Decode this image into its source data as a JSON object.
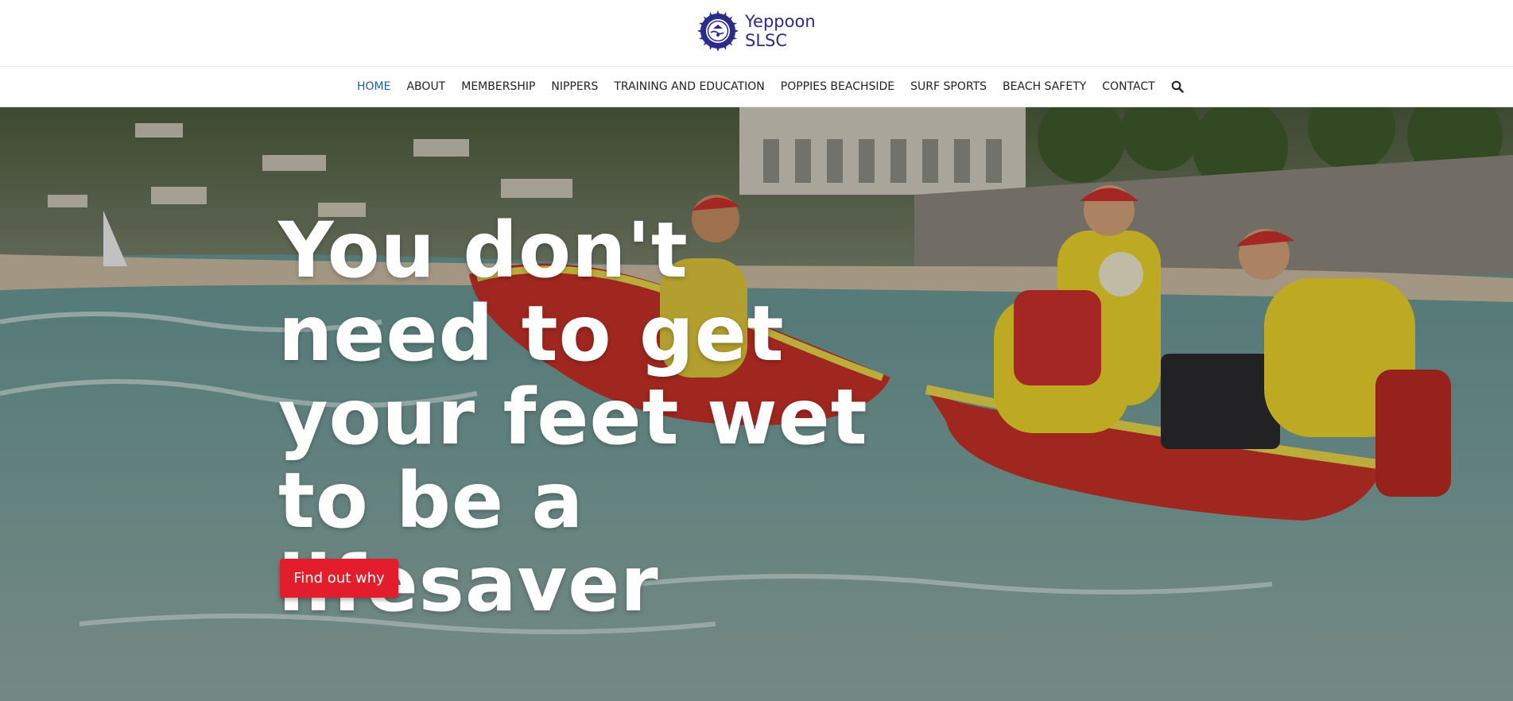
{
  "brand": {
    "name_line1": "Yeppoon",
    "name_line2": "SLSC",
    "color": "#2b2b8a",
    "logo_icon": "lifesaver-badge-icon"
  },
  "nav": {
    "items": [
      {
        "label": "HOME",
        "active": true
      },
      {
        "label": "ABOUT"
      },
      {
        "label": "MEMBERSHIP"
      },
      {
        "label": "NIPPERS"
      },
      {
        "label": "TRAINING AND EDUCATION"
      },
      {
        "label": "POPPIES BEACHSIDE"
      },
      {
        "label": "SURF SPORTS"
      },
      {
        "label": "BEACH SAFETY"
      },
      {
        "label": "CONTACT"
      }
    ],
    "search_icon": "search-icon",
    "active_color": "#1f5fa8"
  },
  "hero": {
    "title": "You don't need to get your feet wet to be a lifesaver",
    "cta_label": "Find out why",
    "cta_color": "#e31d2b",
    "background": "photo of lifesavers in red and yellow launching an inflatable rescue boat (IRB) in the surf"
  }
}
